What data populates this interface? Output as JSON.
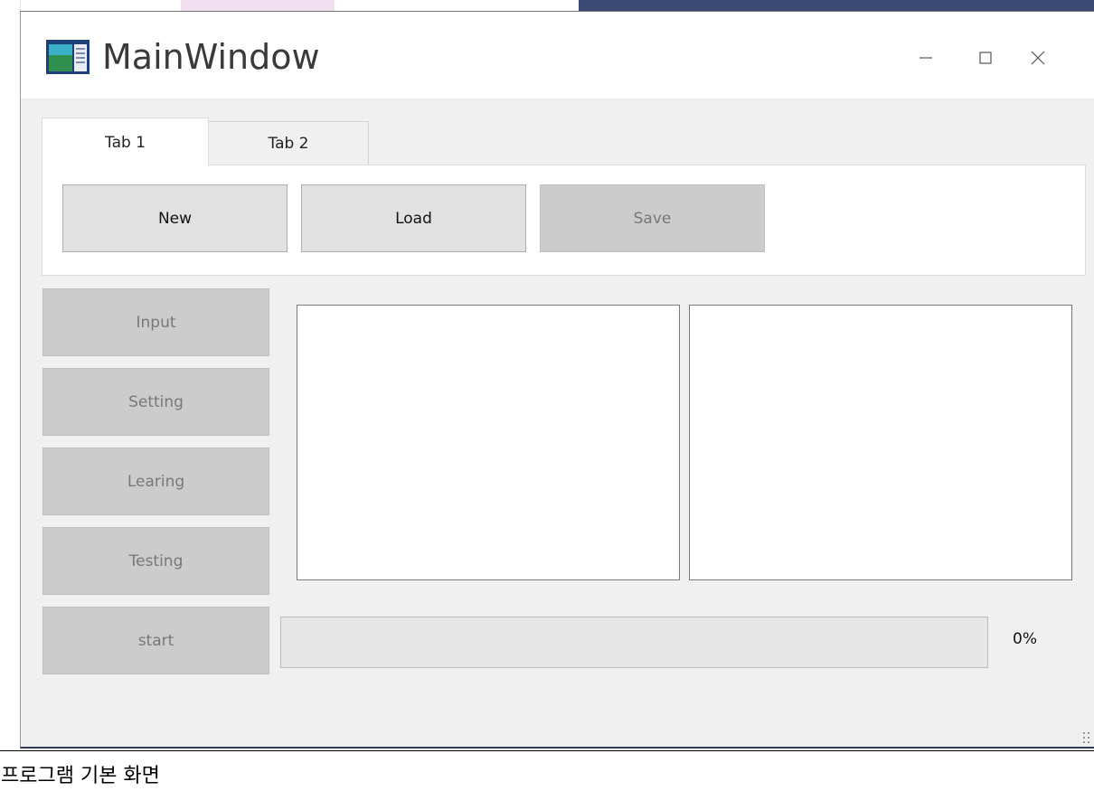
{
  "window": {
    "title": "MainWindow",
    "icon": "app-window-icon",
    "controls": {
      "minimize": "minimize-icon",
      "maximize": "maximize-icon",
      "close": "close-icon"
    }
  },
  "tabs": [
    {
      "label": "Tab 1",
      "active": true
    },
    {
      "label": "Tab 2",
      "active": false
    }
  ],
  "toolbar": {
    "new_label": "New",
    "load_label": "Load",
    "save_label": "Save"
  },
  "side_buttons": {
    "input_label": "Input",
    "setting_label": "Setting",
    "learing_label": "Learing",
    "testing_label": "Testing",
    "start_label": "start"
  },
  "progress": {
    "value": 0,
    "label": "0%"
  },
  "caption": "프로그램 기본 화면",
  "colors": {
    "accent_blue": "#2e3c57",
    "button_enabled": "#e1e1e1",
    "button_disabled": "#cccccc"
  }
}
